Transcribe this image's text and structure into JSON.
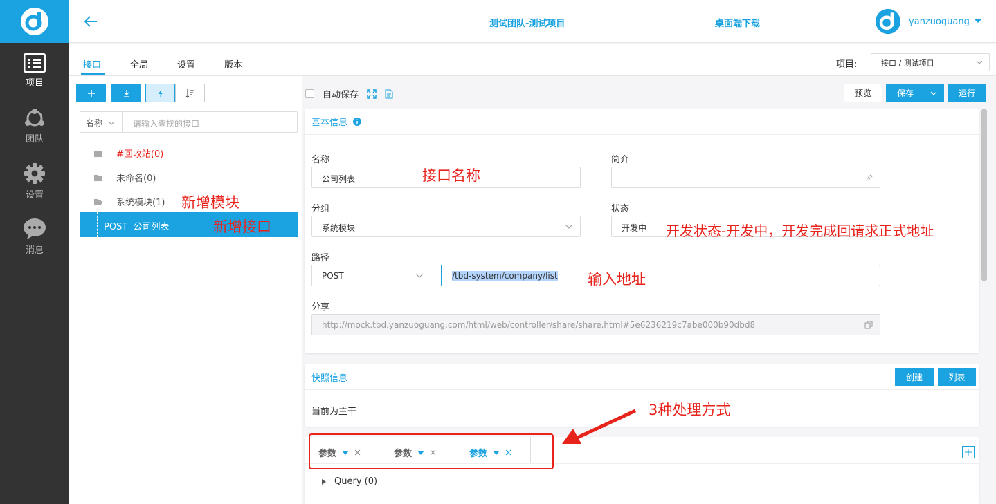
{
  "rail": {
    "items": [
      {
        "label": "项目",
        "icon": "list-icon"
      },
      {
        "label": "团队",
        "icon": "team-icon"
      },
      {
        "label": "设置",
        "icon": "gear-icon"
      },
      {
        "label": "消息",
        "icon": "chat-icon"
      }
    ]
  },
  "header": {
    "title": "测试团队-测试项目",
    "download": "桌面端下载",
    "username": "yanzuoguang"
  },
  "tabs": [
    "接口",
    "全局",
    "设置",
    "版本"
  ],
  "project": {
    "label": "项目:",
    "value": "接口 / 测试项目"
  },
  "left": {
    "search_select": "名称",
    "search_placeholder": "请输入查找的接口",
    "tree": [
      {
        "label": "#回收站(0)",
        "color": "#e8231c"
      },
      {
        "label": "未命名(0)"
      },
      {
        "label": "系统模块(1)"
      }
    ],
    "active_item": "POST  公司列表"
  },
  "toolbar": {
    "autosave": "自动保存",
    "preview": "预览",
    "save": "保存",
    "run": "运行"
  },
  "basic": {
    "title": "基本信息",
    "name_label": "名称",
    "name_value": "公司列表",
    "desc_label": "简介",
    "group_label": "分组",
    "group_value": "系统模块",
    "status_label": "状态",
    "status_value": "开发中",
    "path_label": "路径",
    "method_value": "POST",
    "path_value": "/tbd-system/company/list",
    "share_label": "分享",
    "share_value": "http://mock.tbd.yanzuoguang.com/html/web/controller/share/share.html#5e6236219c7abe000b90dbd8"
  },
  "snapshot": {
    "title": "快照信息",
    "create": "创建",
    "list": "列表",
    "current": "当前为主干"
  },
  "params": {
    "tabs": [
      "参数",
      "参数",
      "参数"
    ],
    "query": "Query (0)"
  },
  "annotations": {
    "module": "新增模块",
    "api": "新增接口",
    "name": "接口名称",
    "status": "开发状态-开发中，开发完成回请求正式地址",
    "address": "输入地址",
    "three": "3种处理方式"
  },
  "colors": {
    "accent": "#1aa3e0",
    "annotation": "#e8231c",
    "rail": "#333333"
  }
}
